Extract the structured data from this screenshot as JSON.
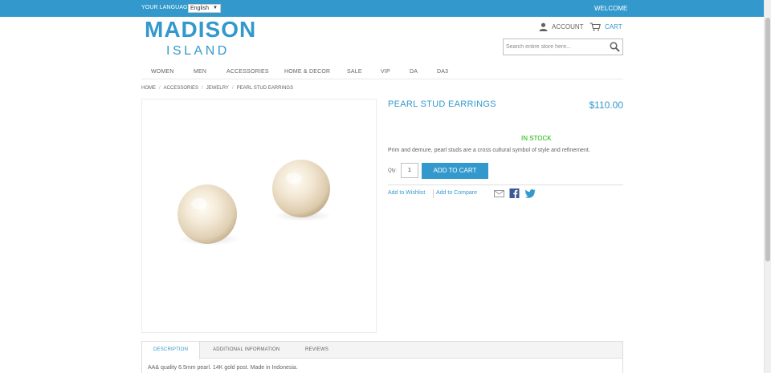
{
  "topbar": {
    "language_label": "YOUR LANGUAGE:",
    "language_value": "English",
    "welcome": "WELCOME"
  },
  "logo": {
    "line1": "MADISON",
    "line2": "ISLAND"
  },
  "header": {
    "account": "ACCOUNT",
    "cart": "CART"
  },
  "search": {
    "placeholder": "Search entire store here..."
  },
  "nav": {
    "items": [
      {
        "label": "WOMEN"
      },
      {
        "label": "MEN"
      },
      {
        "label": "ACCESSORIES"
      },
      {
        "label": "HOME & DECOR"
      },
      {
        "label": "SALE"
      },
      {
        "label": "VIP"
      },
      {
        "label": "DA"
      },
      {
        "label": "DA3"
      }
    ]
  },
  "breadcrumb": {
    "items": [
      "HOME",
      "ACCESSORIES",
      "JEWELRY"
    ],
    "separator": "/",
    "current": "PEARL STUD EARRINGS"
  },
  "product": {
    "name": "PEARL STUD EARRINGS",
    "price": "$110.00",
    "stock": "IN STOCK",
    "short_description": "Prim and demure, pearl studs are a cross cultural symbol of style and refinement.",
    "qty_label": "Qty:",
    "qty_value": "1",
    "add_to_cart": "ADD TO CART",
    "wishlist": "Add to Wishlist",
    "compare": "Add to Compare"
  },
  "icons": {
    "account": "user-icon",
    "cart": "cart-icon",
    "search": "magnifier-icon",
    "email": "envelope-icon",
    "facebook": "facebook-icon",
    "twitter": "twitter-icon"
  },
  "tabs": {
    "items": [
      {
        "label": "DESCRIPTION"
      },
      {
        "label": "ADDITIONAL INFORMATION"
      },
      {
        "label": "REVIEWS"
      }
    ],
    "active_content": "AA& quality 6.5mm pearl. 14K gold post. Made in Indonesia."
  },
  "colors": {
    "accent": "#3399cc",
    "stock": "#11b400",
    "text": "#636363"
  }
}
